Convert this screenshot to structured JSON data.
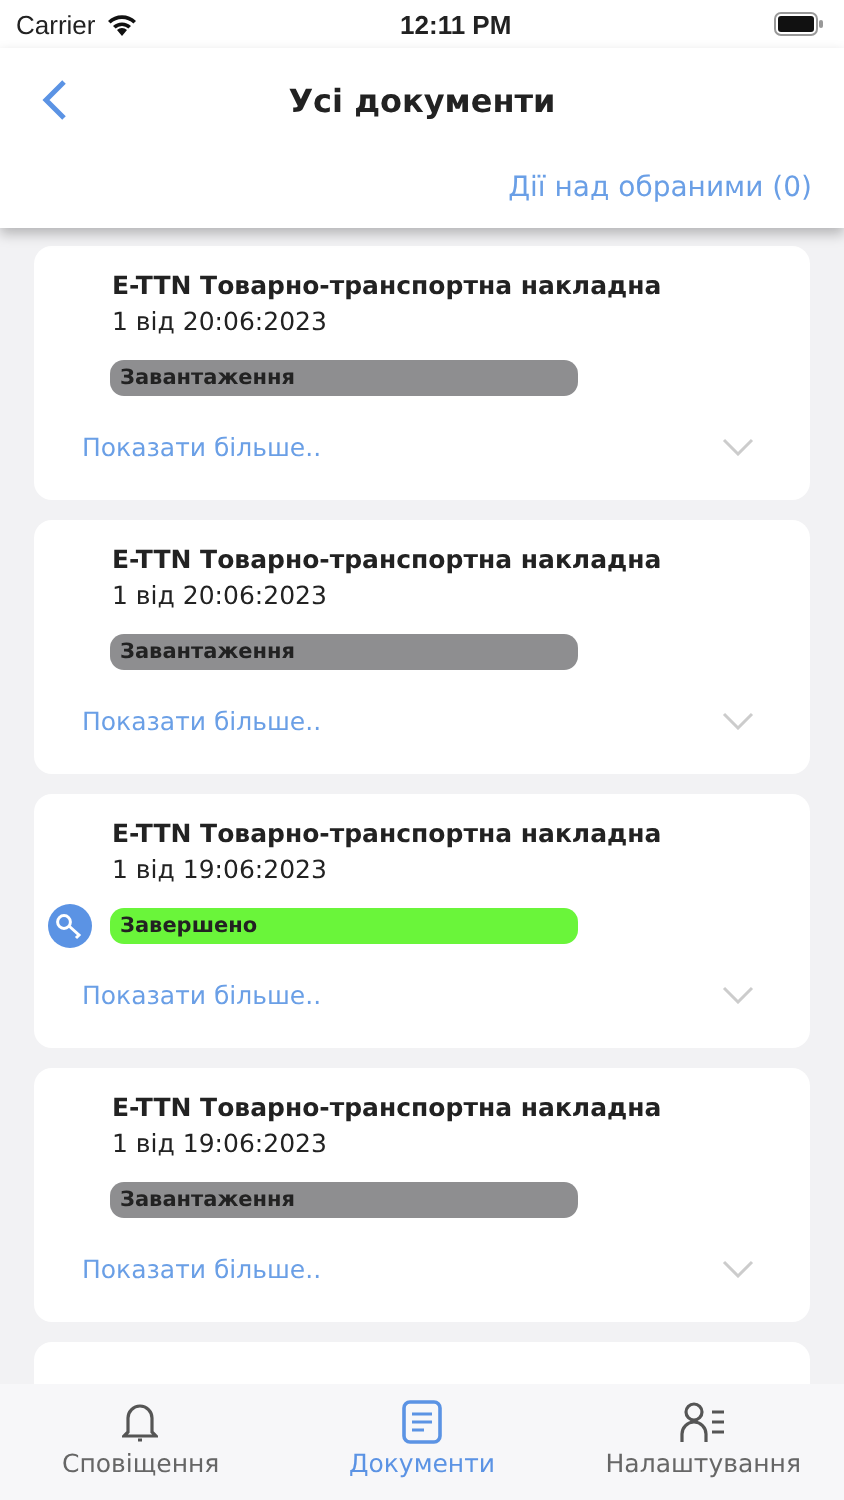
{
  "status_bar": {
    "carrier": "Carrier",
    "time": "12:11 PM"
  },
  "nav": {
    "title": "Усі документи",
    "action": "Дії над обраними (0)"
  },
  "documents": [
    {
      "title": "E-TTN Товарно-транспортна накладна",
      "date": "1 від 20:06:2023",
      "status": "Завантаження",
      "color": "#8e8e90",
      "signed": false,
      "more": "Показати більше.."
    },
    {
      "title": "E-TTN Товарно-транспортна накладна",
      "date": "1 від 20:06:2023",
      "status": "Завантаження",
      "color": "#8e8e90",
      "signed": false,
      "more": "Показати більше.."
    },
    {
      "title": "E-TTN Товарно-транспортна накладна",
      "date": "1 від 19:06:2023",
      "status": "Завершено",
      "color": "#6af53a",
      "signed": true,
      "more": "Показати більше.."
    },
    {
      "title": "E-TTN Товарно-транспортна накладна",
      "date": "1 від 19:06:2023",
      "status": "Завантаження",
      "color": "#8e8e90",
      "signed": false,
      "more": "Показати більше.."
    }
  ],
  "tabs": [
    {
      "label": "Сповіщення",
      "kind": "bell",
      "selected": false
    },
    {
      "label": "Документи",
      "kind": "document",
      "selected": true
    },
    {
      "label": "Налаштування",
      "kind": "profile",
      "selected": false
    }
  ]
}
